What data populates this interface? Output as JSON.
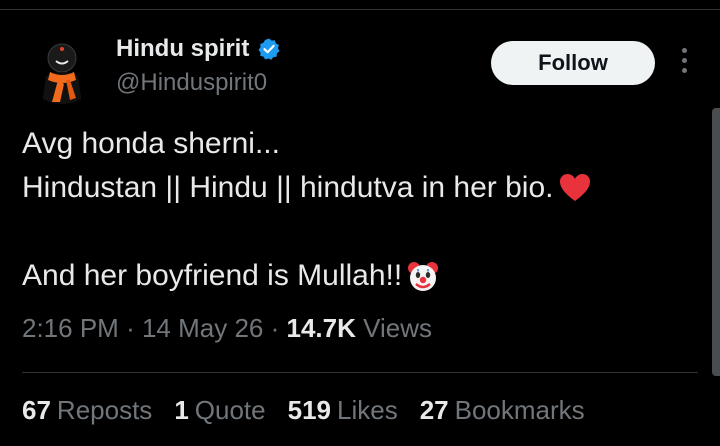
{
  "author": {
    "display_name": "Hindu spirit",
    "handle": "@Hinduspirit0",
    "verified": true,
    "avatar_icon": "orange-scarf-figure-avatar"
  },
  "follow_label": "Follow",
  "more_icon": "vertical-ellipsis-icon",
  "post": {
    "line1": "Avg honda sherni...",
    "line2": "Hindustan || Hindu || hindutva in her bio.",
    "line2_emoji": "red-heart-emoji",
    "line3": "And her boyfriend is Mullah!!",
    "line3_emoji": "clown-face-emoji"
  },
  "meta": {
    "time": "2:16 PM",
    "sep1": "·",
    "date": "14 May 26",
    "sep2": "·",
    "views_count": "14.7K",
    "views_label": "Views"
  },
  "stats": {
    "reposts_count": "67",
    "reposts_label": "Reposts",
    "quotes_count": "1",
    "quotes_label": "Quote",
    "likes_count": "519",
    "likes_label": "Likes",
    "bookmarks_count": "27",
    "bookmarks_label": "Bookmarks"
  },
  "colors": {
    "background": "#000000",
    "text": "#e7e9ea",
    "secondary": "#71767b",
    "verified_blue": "#1d9bf0",
    "follow_bg": "#eff3f4",
    "divider": "#2f3336"
  }
}
